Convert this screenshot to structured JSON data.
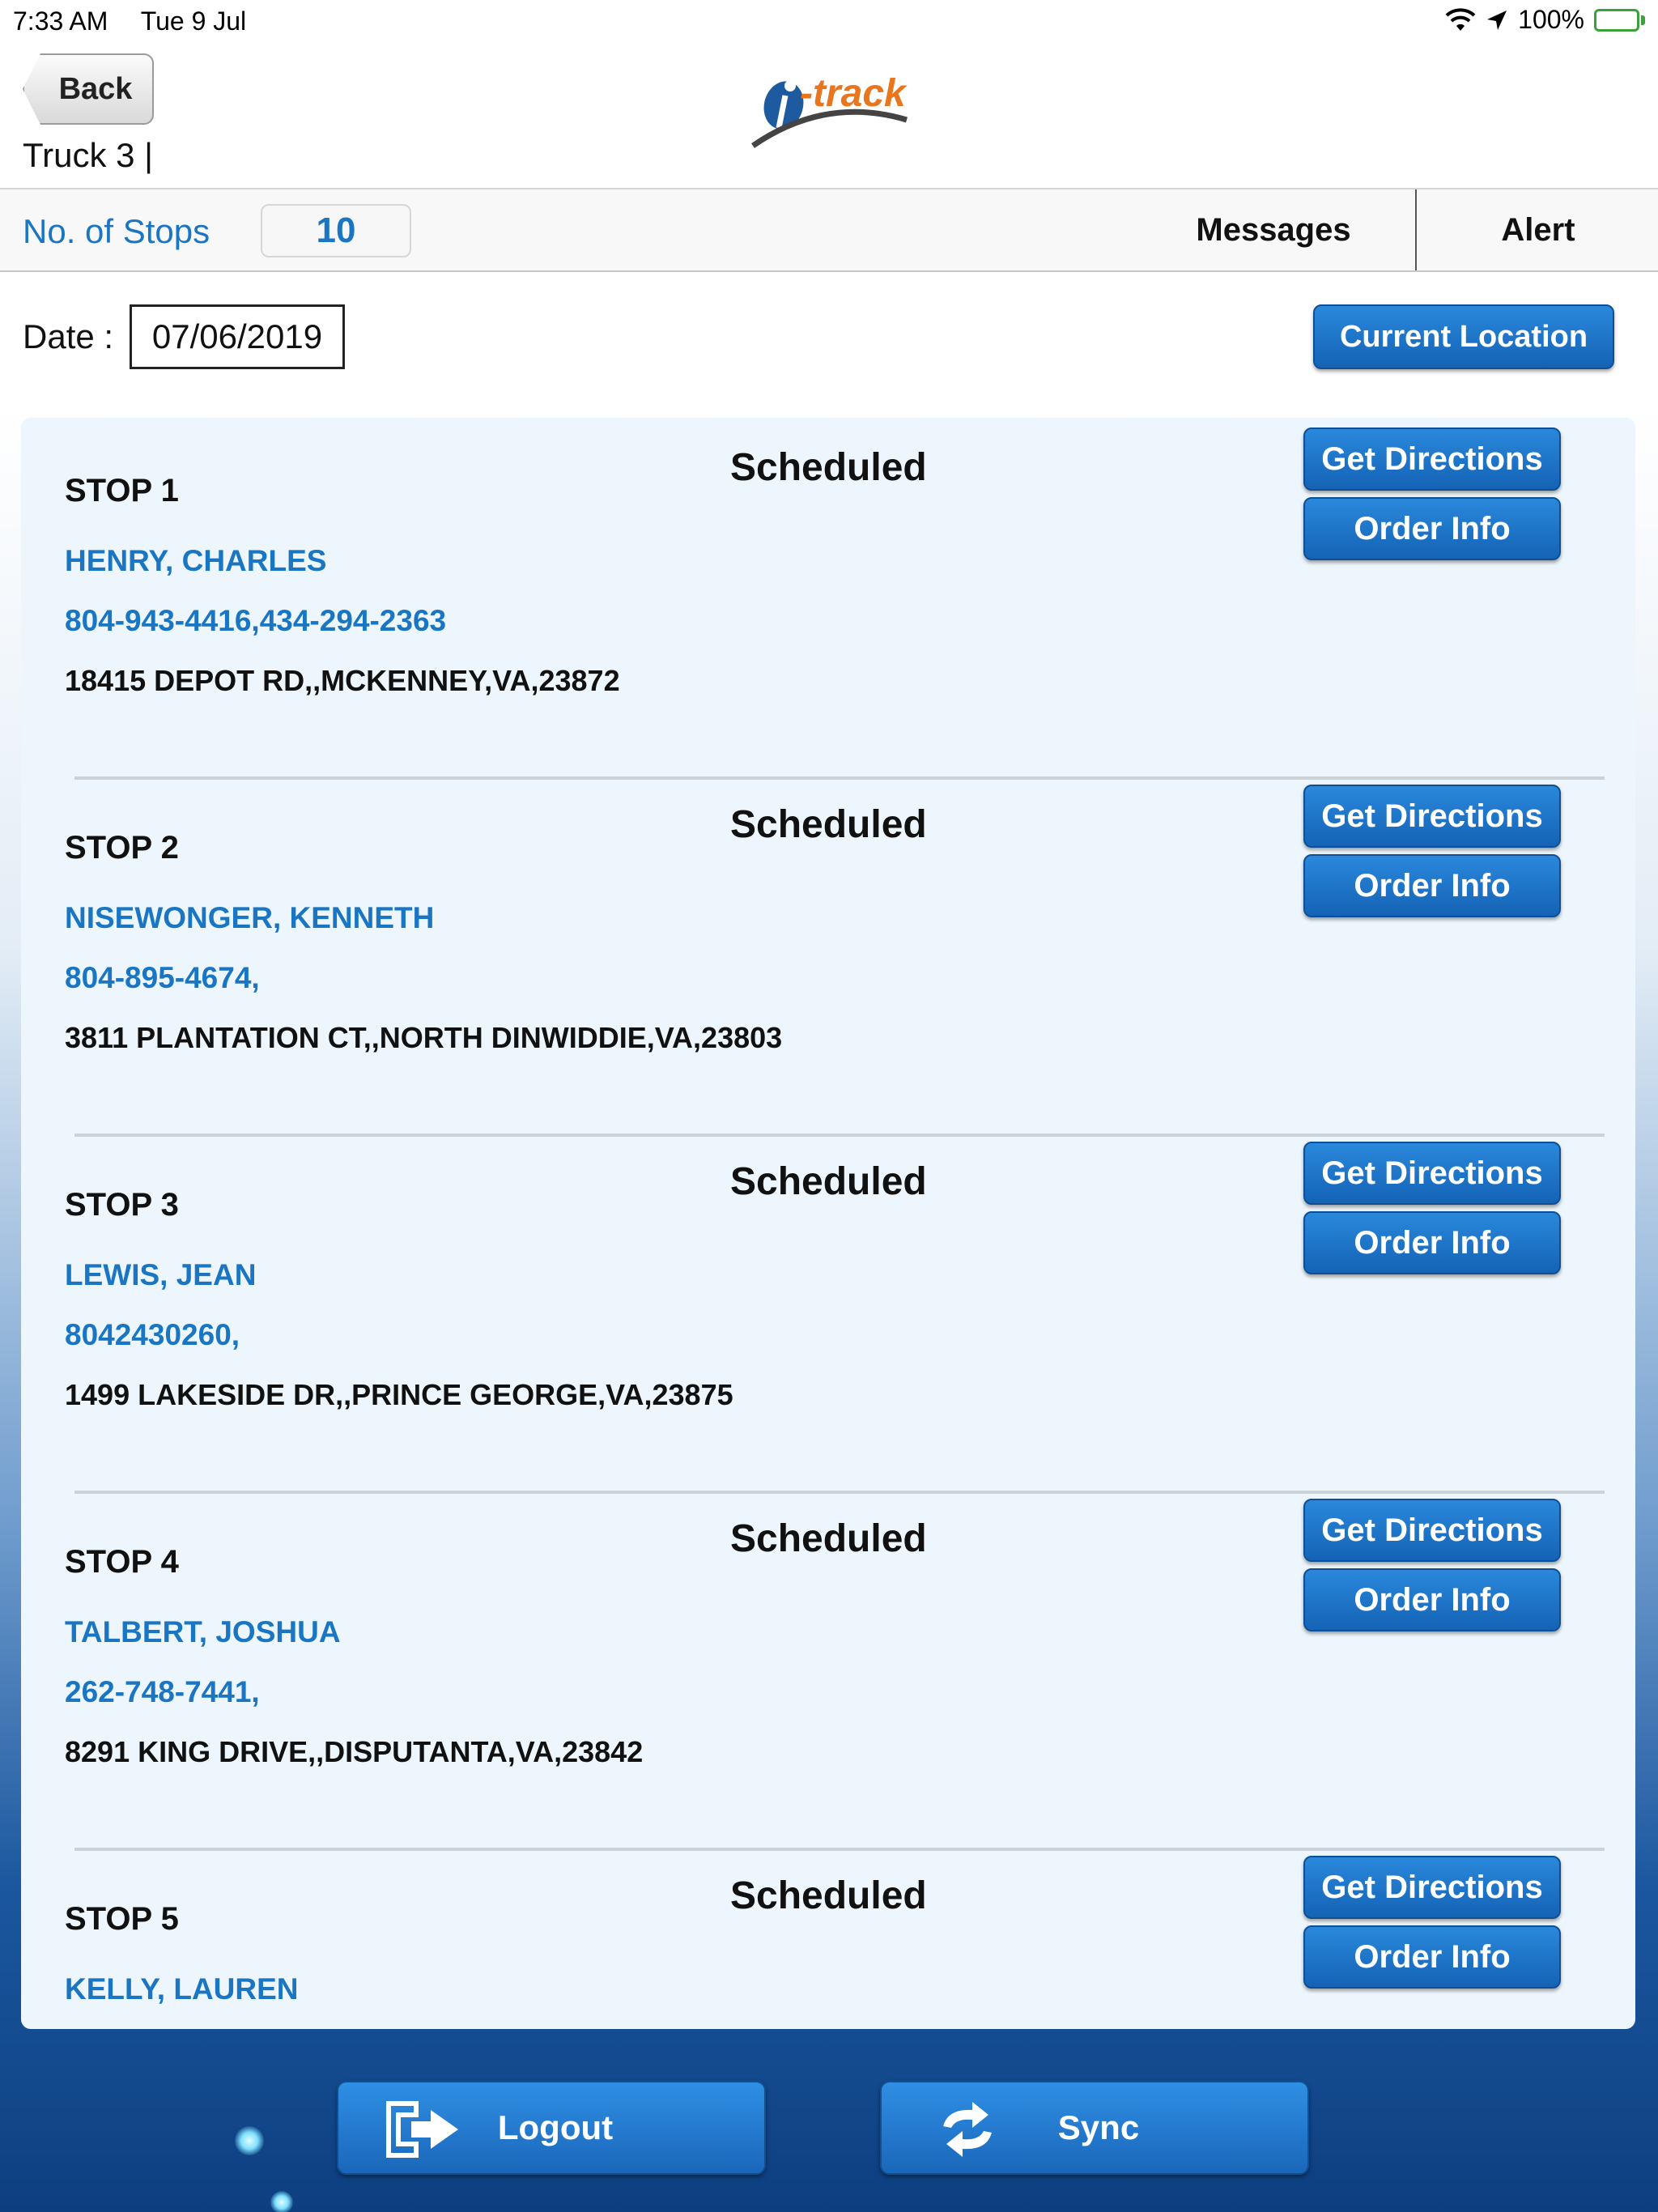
{
  "status_bar": {
    "time": "7:33 AM",
    "date": "Tue 9 Jul",
    "battery": "100%",
    "wifi_icon": "wifi-icon",
    "location_icon": "location-arrow-icon"
  },
  "header": {
    "back_label": "Back",
    "truck_label": "Truck 3 |",
    "logo_text": "-track",
    "logo_color": "#e8761e"
  },
  "toolbar": {
    "stops_label": "No. of Stops",
    "stops_count": "10",
    "messages_label": "Messages",
    "alert_label": "Alert"
  },
  "date_row": {
    "label": "Date :",
    "value": "07/06/2019",
    "current_location_label": "Current Location"
  },
  "stops": [
    {
      "title": "STOP 1",
      "status": "Scheduled",
      "name": "HENRY, CHARLES",
      "phone": "804-943-4416,434-294-2363",
      "address": "18415 DEPOT RD,,MCKENNEY,VA,23872",
      "directions_label": "Get Directions",
      "order_label": "Order Info"
    },
    {
      "title": "STOP 2",
      "status": "Scheduled",
      "name": "NISEWONGER,  KENNETH",
      "phone": "804-895-4674,",
      "address": "3811 PLANTATION CT,,NORTH DINWIDDIE,VA,23803",
      "directions_label": "Get Directions",
      "order_label": "Order Info"
    },
    {
      "title": "STOP 3",
      "status": "Scheduled",
      "name": "LEWIS, JEAN",
      "phone": "8042430260,",
      "address": "1499 LAKESIDE DR,,PRINCE GEORGE,VA,23875",
      "directions_label": "Get Directions",
      "order_label": "Order Info"
    },
    {
      "title": "STOP 4",
      "status": "Scheduled",
      "name": "TALBERT,  JOSHUA",
      "phone": "262-748-7441,",
      "address": "8291 KING DRIVE,,DISPUTANTA,VA,23842",
      "directions_label": "Get Directions",
      "order_label": "Order Info"
    },
    {
      "title": "STOP 5",
      "status": "Scheduled",
      "name": "KELLY, LAUREN",
      "phone": "",
      "address": "",
      "directions_label": "Get Directions",
      "order_label": "Order Info"
    }
  ],
  "bottom_bar": {
    "logout_label": "Logout",
    "sync_label": "Sync"
  },
  "colors": {
    "accent_blue": "#1a76c2",
    "button_blue": "#1463b6",
    "card_bg": "#ecf6fc"
  }
}
